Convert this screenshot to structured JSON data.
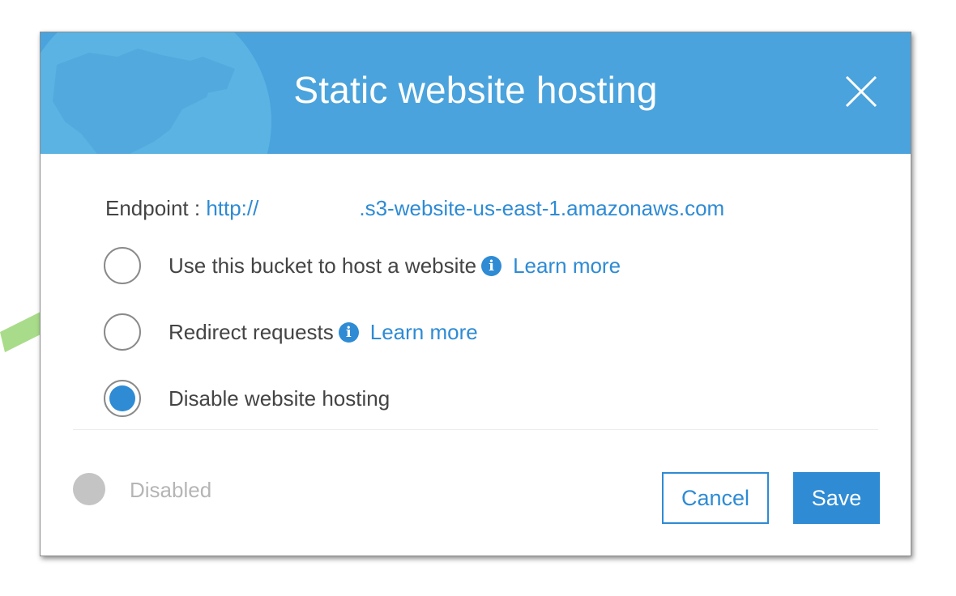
{
  "dialog": {
    "title": "Static website hosting",
    "endpoint_label": "Endpoint : ",
    "endpoint_prefix": "http://",
    "endpoint_suffix": ".s3-website-us-east-1.amazonaws.com"
  },
  "options": [
    {
      "label": "Use this bucket to host a website",
      "info": "i",
      "learn_more": "Learn more",
      "selected": false
    },
    {
      "label": "Redirect requests",
      "info": "i",
      "learn_more": "Learn more",
      "selected": false
    },
    {
      "label": "Disable website hosting",
      "selected": true
    }
  ],
  "status": {
    "label": "Disabled",
    "color": "#c4c4c4"
  },
  "buttons": {
    "cancel": "Cancel",
    "save": "Save"
  },
  "colors": {
    "header": "#4aa3dc",
    "accent": "#2e8bd4",
    "arrow": "#a9dc8a"
  },
  "icons": [
    "globe-icon",
    "close-icon",
    "info-icon",
    "pointer-arrow"
  ]
}
